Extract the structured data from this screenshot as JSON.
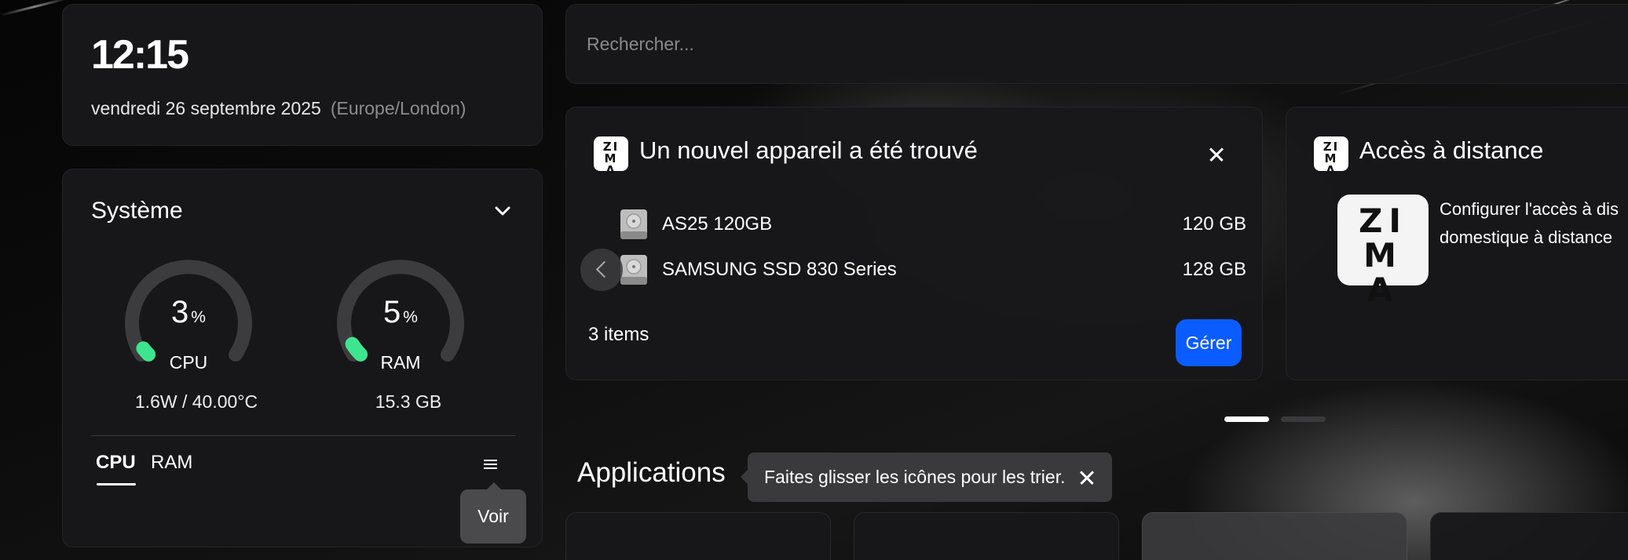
{
  "clock": {
    "time": "12:15",
    "date": "vendredi 26 septembre 2025",
    "timezone": "(Europe/London)"
  },
  "system": {
    "title": "Système",
    "cpu": {
      "value": "3",
      "unit": "%",
      "label": "CPU",
      "detail": "1.6W / 40.00°C",
      "level": 0.03
    },
    "ram": {
      "value": "5",
      "unit": "%",
      "label": "RAM",
      "detail": "15.3 GB",
      "level": 0.05
    },
    "tabs": [
      "CPU",
      "RAM"
    ],
    "menu_tooltip": "Voir",
    "gauge_color": "#3ee58f"
  },
  "search": {
    "placeholder": "Rechercher..."
  },
  "device_card": {
    "logo": "ZIMA",
    "title": "Un nouvel appareil a été trouvé",
    "devices": [
      {
        "name": "AS25 120GB",
        "size": "120 GB",
        "icon": "hard-disk-icon"
      },
      {
        "name": "SAMSUNG SSD 830 Series",
        "size": "128 GB",
        "icon": "hard-disk-icon"
      }
    ],
    "items_count": "3 items",
    "manage_label": "Gérer",
    "accent": "#0a5cff"
  },
  "remote_card": {
    "logo": "ZIMA",
    "title": "Accès à distance",
    "description_line1": "Configurer l'accès à dis",
    "description_line2": "domestique à distance"
  },
  "applications": {
    "title": "Applications",
    "hint": "Faites glisser les icônes pour les trier."
  }
}
